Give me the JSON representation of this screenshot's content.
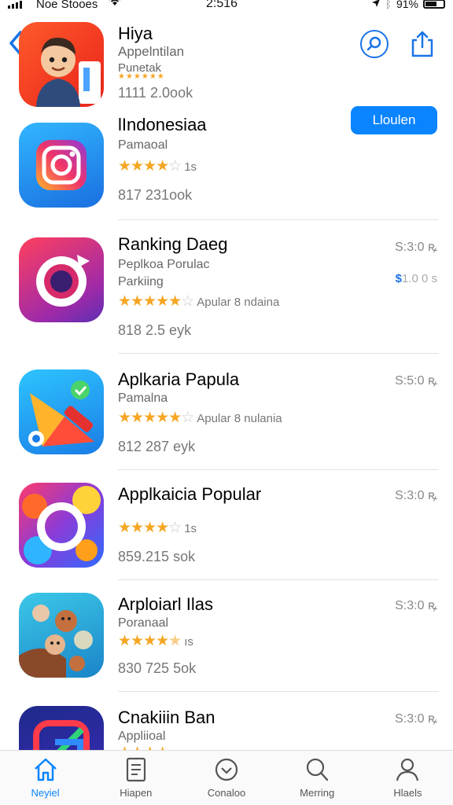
{
  "status_bar": {
    "carrier": "Noe Stooes",
    "time": "2:516",
    "battery": "91%"
  },
  "featured": {
    "name": "Hiya",
    "subtitle1": "Appelntilan",
    "subtitle2": "Punetak",
    "stars_small": "★★★★★★",
    "downloads": "1111 2.0ook"
  },
  "get_button": "Lloulen",
  "apps": [
    {
      "name": "lIndonesiaa",
      "subtitle": "Pamaoal",
      "stars": 4,
      "rating_text": "1s",
      "downloads": "817 231ook",
      "price": ""
    },
    {
      "name": "Ranking Daeg",
      "subtitle": "Peplkoa Porulac",
      "subtitle2": "Parkiing",
      "stars": 5,
      "rating_text": "Apular 8 ndaina",
      "downloads": "818 2.5 eyk",
      "price": "S:3:0 ꝶ",
      "price2_symbol": "$",
      "price2": "1.0 0 s"
    },
    {
      "name": "Aplkaria Papula",
      "subtitle": "Pamalna",
      "stars": 5,
      "rating_text": "Apular 8 nulania",
      "downloads": "812 287 eyk",
      "price": "S:5:0 ꝶ"
    },
    {
      "name": "Applkaicia Popular",
      "subtitle": "",
      "stars": 4,
      "rating_text": "1s",
      "downloads": "859.215 sok",
      "price": "S:3:0 ꝶ"
    },
    {
      "name": "Arploiarl Ilas",
      "subtitle": "Poranaal",
      "stars": 4.5,
      "rating_text": "ıs",
      "downloads": "830 725 5ok",
      "price": "S:3:0 ꝶ"
    },
    {
      "name": "Cnakiiin Ban",
      "subtitle": "Appliioal",
      "stars": 4,
      "rating_text": "",
      "downloads": "",
      "price": "S:3:0 ꝶ"
    }
  ],
  "tabs": [
    {
      "label": "Neyiel",
      "icon": "home-icon"
    },
    {
      "label": "Hiapen",
      "icon": "document-icon"
    },
    {
      "label": "Conaloo",
      "icon": "check-circle-icon"
    },
    {
      "label": "Merring",
      "icon": "search-icon"
    },
    {
      "label": "Hlaels",
      "icon": "person-icon"
    }
  ],
  "colors": {
    "accent": "#0a84ff",
    "star": "#f5a623"
  }
}
